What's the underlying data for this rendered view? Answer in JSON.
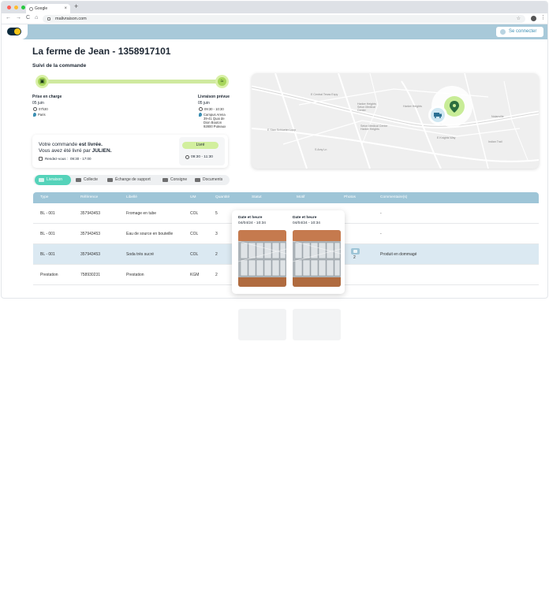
{
  "browser": {
    "tab_title": "Google",
    "tab_close": "×",
    "new_tab": "+",
    "nav_back": "←",
    "nav_forward": "→",
    "nav_reload": "C",
    "nav_home": "⌂",
    "url": "malivraison.com",
    "star": "☆",
    "menu": "⋮"
  },
  "header": {
    "login_label": "Se connecter"
  },
  "page": {
    "title": "La ferme de Jean - 1358917101",
    "subtitle": "Suivi de la commande"
  },
  "tracking": {
    "start": {
      "label": "Prise en charge",
      "date": "05 juin",
      "time": "07h30",
      "place": "Paris"
    },
    "end": {
      "label": "Livraison prévue",
      "date": "05 juin",
      "time": "09:30 - 10:30",
      "address_1": "Campus Arena",
      "address_2": "39-41 Quai de",
      "address_3": "Dion Bouton",
      "address_4": "92800 Puteaux"
    }
  },
  "status": {
    "msg_prefix": "Votre commande ",
    "msg_bold": "est livrée.",
    "msg_line2_prefix": "Vous avez été livré par ",
    "msg_line2_bold": "JULIEN.",
    "appointment_label": "Rendez-vous :",
    "appointment_time": "09:30 - 17:00",
    "badge": "Livré",
    "delivered_time": "09:30 - 11:30"
  },
  "map": {
    "labels": [
      "Harker Heights",
      "Nolanville",
      "Harker Heights Seton Medical Center",
      "Seton Medical Center Harker Heights",
      "E Central Texas Expy",
      "E Stan Schlueter Loop",
      "E Knights Way",
      "S Amy Ln",
      "Indian Trail"
    ]
  },
  "tabs": [
    {
      "label": "Livraison",
      "active": true
    },
    {
      "label": "Collecte",
      "active": false
    },
    {
      "label": "Échange de support",
      "active": false
    },
    {
      "label": "Consigne",
      "active": false
    },
    {
      "label": "Documents",
      "active": false
    }
  ],
  "table": {
    "headers": [
      "Type",
      "Référence",
      "Libellé",
      "UM",
      "Quantité",
      "Statut",
      "Motif",
      "Photos",
      "Commentaire(s)"
    ],
    "rows": [
      {
        "type": "BL - 001",
        "ref": "357943453",
        "label": "Fromage en tube",
        "um": "COL",
        "qty": "5",
        "photos": "",
        "comment": "-"
      },
      {
        "type": "BL - 001",
        "ref": "357943453",
        "label": "Eau de source en bouteille",
        "um": "COL",
        "qty": "3",
        "photos": "",
        "comment": "-"
      },
      {
        "type": "BL - 001",
        "ref": "357943453",
        "label": "Soda très sucré",
        "um": "COL",
        "qty": "2",
        "photos": "2",
        "comment": "Produit en dommagé"
      },
      {
        "type": "Prestation",
        "ref": "758930231",
        "label": "Prestation",
        "um": "KGM",
        "qty": "2",
        "photos": "",
        "comment": "-"
      }
    ]
  },
  "popover": {
    "label": "Date et heure",
    "photos": [
      {
        "date": "04/04/24 - 10:34"
      },
      {
        "date": "04/04/24 - 10:34"
      }
    ]
  },
  "colors": {
    "accent": "#55d3ba",
    "header": "#a8c9d9",
    "table_head": "#9ec5d7",
    "green": "#a7d65a",
    "pin": "#2c6e3f"
  }
}
